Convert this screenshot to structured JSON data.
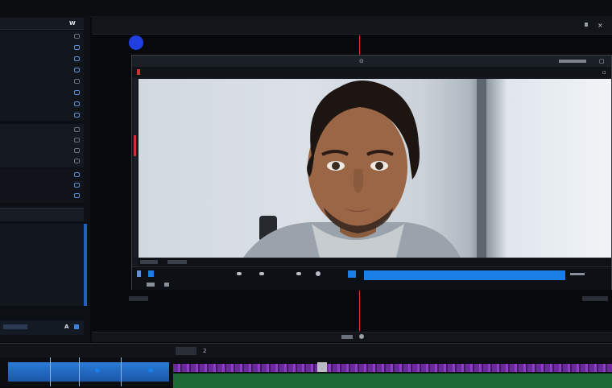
{
  "menubar": {
    "items": [
      "",
      "",
      "",
      "",
      "",
      "",
      "",
      ""
    ]
  },
  "left_panel": {
    "header_label": "",
    "header_value": "W",
    "group1_rows": [
      "",
      "",
      "",
      "",
      "",
      "",
      "",
      ""
    ],
    "group2_rows": [
      "",
      "",
      "",
      ""
    ],
    "group3_rows": [
      "",
      "",
      ""
    ],
    "section_title": "",
    "group4_rows": [
      "",
      "",
      "",
      "",
      "",
      "",
      "",
      "",
      ""
    ],
    "footer_value": "A"
  },
  "main": {
    "title": "",
    "inner_window": {
      "title": "",
      "clip_name": ""
    },
    "controls": {
      "timecode_left": "",
      "timecode_right": ""
    }
  },
  "timeline": {
    "labels": [
      "",
      "",
      "",
      "",
      "",
      "2",
      ""
    ]
  },
  "colors": {
    "accent": "#1b7de6",
    "playhead": "#d33a2e",
    "clip_purple": "#7a35b3",
    "clip_green": "#1c6b34",
    "record_dot": "#1f3fe0"
  }
}
